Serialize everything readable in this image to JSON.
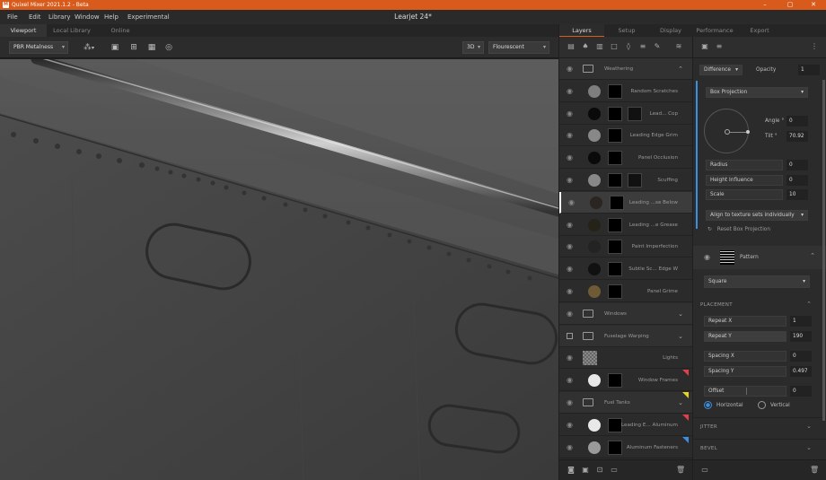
{
  "app": {
    "title": "Quixel Mixer 2021.1.2 - Beta",
    "document_title": "Learjet 24*",
    "window_controls": [
      "–",
      "▢",
      "✕"
    ]
  },
  "menu": [
    "File",
    "Edit",
    "Library",
    "Window",
    "Help",
    "Experimental"
  ],
  "left_tabs": [
    "Viewport",
    "Local Library",
    "Online"
  ],
  "viewport_toolbar": {
    "material_mode": "PBR Metalness",
    "view_mode": "3D",
    "lighting": "Flourescent"
  },
  "right_tabs": [
    "Layers",
    "Setup",
    "Display",
    "Performance",
    "Export"
  ],
  "layers": [
    {
      "type": "folder",
      "name": "Weathering",
      "chev": "^"
    },
    {
      "type": "layer",
      "name": "Random Scratches",
      "circle": "#7e7e7e"
    },
    {
      "type": "layer",
      "name": "Lead... Cop",
      "circle": "#0a0a0a",
      "mask2": true
    },
    {
      "type": "layer",
      "name": "Leading Edge Grim",
      "circle": "#888888"
    },
    {
      "type": "layer",
      "name": "Panel Occlusion",
      "circle": "#0a0a0a"
    },
    {
      "type": "layer",
      "name": "Scuffing",
      "circle": "#888888",
      "mask2": true
    },
    {
      "type": "layer",
      "name": "Leading ...se Below",
      "circle": "#2a2520",
      "selected": true
    },
    {
      "type": "layer",
      "name": "Leading ...e Grease",
      "circle": "#252218"
    },
    {
      "type": "layer",
      "name": "Paint Imperfection",
      "circle": "#232323"
    },
    {
      "type": "layer",
      "name": "Subtle Sc... Edge W",
      "circle": "#111111"
    },
    {
      "type": "layer",
      "name": "Panel Grime",
      "circle": "#6e5a35"
    },
    {
      "type": "folder",
      "name": "Windows",
      "chev": "v"
    },
    {
      "type": "folder",
      "name": "Fuselage Warping",
      "chev": "v",
      "checkbox": true
    },
    {
      "type": "layer",
      "name": "Lights",
      "checker": true
    },
    {
      "type": "layer",
      "name": "Window Frames",
      "circle": "#e8e8e8",
      "flag": "#e0404a"
    },
    {
      "type": "folder",
      "name": "Fuel Tanks",
      "chev": "v",
      "flag": "#e8d420"
    },
    {
      "type": "layer",
      "name": "Leading E... Aluminum",
      "circle": "#e8e8e8",
      "flag": "#e0404a"
    },
    {
      "type": "layer",
      "name": "Aluminum Fasteners",
      "circle": "#9a9a9a",
      "flag": "#3a8fe0"
    }
  ],
  "props": {
    "blend_mode": "Difference",
    "opacity_label": "Opacity",
    "opacity_value": "1",
    "projection": "Box Projection",
    "angle_label": "Angle °",
    "angle_value": "0",
    "tilt_label": "Tilt °",
    "tilt_value": "70.92",
    "radius_label": "Radius",
    "radius_value": "0",
    "height_label": "Height Influence",
    "height_value": "0",
    "scale_label": "Scale",
    "scale_value": "10",
    "align_option": "Align to texture sets individually",
    "reset_label": "Reset Box Projection",
    "pattern_label": "Pattern",
    "pattern_shape": "Square",
    "placement_heading": "PLACEMENT",
    "repeat_x_label": "Repeat X",
    "repeat_x_value": "1",
    "repeat_y_label": "Repeat Y",
    "repeat_y_value": "190",
    "spacing_x_label": "Spacing X",
    "spacing_x_value": "0",
    "spacing_y_label": "Spacing Y",
    "spacing_y_value": "0.497",
    "offset_label": "Offset",
    "offset_value": "0",
    "horizontal_label": "Horizontal",
    "vertical_label": "Vertical",
    "jitter_heading": "JITTER",
    "bevel_heading": "BEVEL"
  },
  "colors": {
    "accent": "#d95b1c",
    "selection_blue": "#3a8fe0"
  }
}
